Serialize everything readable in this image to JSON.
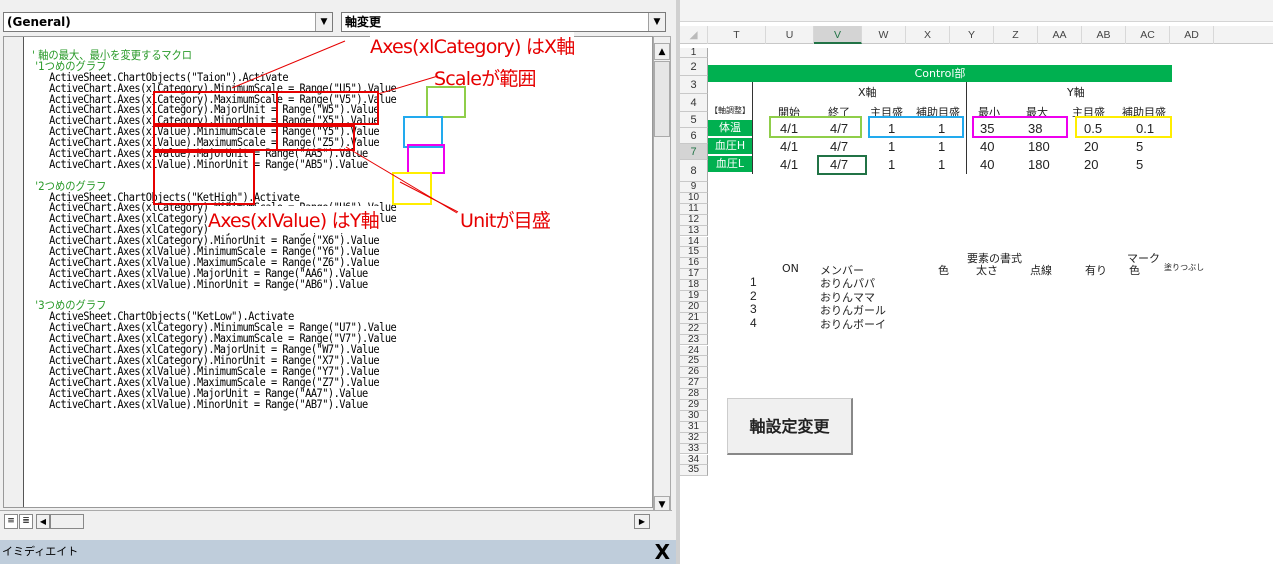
{
  "vbe": {
    "object_combo": "(General)",
    "procedure_combo": "軸変更",
    "code_lines": [
      {
        "type": "comment",
        "text": "' 軸の最大、最小を変更するマクロ"
      },
      {
        "type": "comment",
        "text": " '1つめのグラフ"
      },
      {
        "type": "code",
        "text": "   ActiveSheet.ChartObjects(\"Taion\").Activate"
      },
      {
        "type": "code",
        "text": "   ActiveChart.Axes(xlCategory).MinimumScale = Range(\"U5\").Value"
      },
      {
        "type": "code",
        "text": "   ActiveChart.Axes(xlCategory).MaximumScale = Range(\"V5\").Value"
      },
      {
        "type": "code",
        "text": "   ActiveChart.Axes(xlCategory).MajorUnit = Range(\"W5\").Value"
      },
      {
        "type": "code",
        "text": "   ActiveChart.Axes(xlCategory).MinorUnit = Range(\"X5\").Value"
      },
      {
        "type": "code",
        "text": "   ActiveChart.Axes(xlValue).MinimumScale = Range(\"Y5\").Value"
      },
      {
        "type": "code",
        "text": "   ActiveChart.Axes(xlValue).MaximumScale = Range(\"Z5\").Value"
      },
      {
        "type": "code",
        "text": "   ActiveChart.Axes(xlValue).MajorUnit = Range(\"AA5\").Value"
      },
      {
        "type": "code",
        "text": "   ActiveChart.Axes(xlValue).MinorUnit = Range(\"AB5\").Value"
      },
      {
        "type": "blank",
        "text": ""
      },
      {
        "type": "comment",
        "text": " '2つめのグラフ"
      },
      {
        "type": "code",
        "text": "   ActiveSheet.ChartObjects(\"KetHigh\").Activate"
      },
      {
        "type": "code",
        "text": "   ActiveChart.Axes(xlCategory).MinimumScale = Range(\"U6\").Value"
      },
      {
        "type": "code",
        "text": "   ActiveChart.Axes(xlCategory).MaximumScale = Range(\"V6\").Value"
      },
      {
        "type": "code",
        "text": "   ActiveChart.Axes(xlCategory).MajorUnit = Range(\"W6\").Value"
      },
      {
        "type": "code",
        "text": "   ActiveChart.Axes(xlCategory).MinorUnit = Range(\"X6\").Value"
      },
      {
        "type": "code",
        "text": "   ActiveChart.Axes(xlValue).MinimumScale = Range(\"Y6\").Value"
      },
      {
        "type": "code",
        "text": "   ActiveChart.Axes(xlValue).MaximumScale = Range(\"Z6\").Value"
      },
      {
        "type": "code",
        "text": "   ActiveChart.Axes(xlValue).MajorUnit = Range(\"AA6\").Value"
      },
      {
        "type": "code",
        "text": "   ActiveChart.Axes(xlValue).MinorUnit = Range(\"AB6\").Value"
      },
      {
        "type": "blank",
        "text": ""
      },
      {
        "type": "comment",
        "text": " '3つめのグラフ"
      },
      {
        "type": "code",
        "text": "   ActiveSheet.ChartObjects(\"KetLow\").Activate"
      },
      {
        "type": "code",
        "text": "   ActiveChart.Axes(xlCategory).MinimumScale = Range(\"U7\").Value"
      },
      {
        "type": "code",
        "text": "   ActiveChart.Axes(xlCategory).MaximumScale = Range(\"V7\").Value"
      },
      {
        "type": "code",
        "text": "   ActiveChart.Axes(xlCategory).MajorUnit = Range(\"W7\").Value"
      },
      {
        "type": "code",
        "text": "   ActiveChart.Axes(xlCategory).MinorUnit = Range(\"X7\").Value"
      },
      {
        "type": "code",
        "text": "   ActiveChart.Axes(xlValue).MinimumScale = Range(\"Y7\").Value"
      },
      {
        "type": "code",
        "text": "   ActiveChart.Axes(xlValue).MaximumScale = Range(\"Z7\").Value"
      },
      {
        "type": "code",
        "text": "   ActiveChart.Axes(xlValue).MajorUnit = Range(\"AA7\").Value"
      },
      {
        "type": "code",
        "text": "   ActiveChart.Axes(xlValue).MinorUnit = Range(\"AB7\").Value"
      }
    ],
    "immediate_title": "イミディエイト",
    "close_glyph": "X",
    "annotations": {
      "category_note": "Axes(xlCategory) はX軸",
      "scale_note": "Scaleが範囲",
      "value_note": "Axes(xlValue) はY軸",
      "unit_note": "Unitが目盛"
    },
    "annotation_colors": {
      "red": "#e60000",
      "green": "#8fce4a",
      "blue": "#22aaee",
      "magenta": "#ee00ee",
      "yellow": "#ffee00"
    }
  },
  "excel": {
    "columns": [
      "T",
      "U",
      "V",
      "W",
      "X",
      "Y",
      "Z",
      "AA",
      "AB",
      "AC",
      "AD"
    ],
    "selected_column": "V",
    "rows": [
      "1",
      "2",
      "3",
      "4",
      "5",
      "6",
      "7",
      "8",
      "9",
      "10",
      "11",
      "12",
      "13",
      "14",
      "15",
      "16",
      "17",
      "18",
      "19",
      "20",
      "21",
      "22",
      "23",
      "24",
      "25",
      "26",
      "27",
      "28",
      "29",
      "30",
      "31",
      "32",
      "33",
      "34",
      "35"
    ],
    "selected_row": "7",
    "control_title": "Control部",
    "x_axis_label": "X軸",
    "y_axis_label": "Y軸",
    "adjust_label": "【軸調整】",
    "headers": [
      "開始",
      "終了",
      "主目盛",
      "補助目盛",
      "最小",
      "最大",
      "主目盛",
      "補助目盛"
    ],
    "table_rows": [
      {
        "name": "体温",
        "values": [
          "4/1",
          "4/7",
          "1",
          "1",
          "35",
          "38",
          "0.5",
          "0.1"
        ]
      },
      {
        "name": "血圧H",
        "values": [
          "4/1",
          "4/7",
          "1",
          "1",
          "40",
          "180",
          "20",
          "5"
        ]
      },
      {
        "name": "血圧L",
        "values": [
          "4/1",
          "4/7",
          "1",
          "1",
          "40",
          "180",
          "20",
          "5"
        ]
      }
    ],
    "green_color": "#00b050",
    "format_section": {
      "element_format": "要素の書式",
      "mark": "マーク",
      "headers": [
        "ON",
        "メンバー",
        "色",
        "太さ",
        "点線",
        "有り",
        "色",
        "塗りつぶし"
      ],
      "members": [
        {
          "no": "1",
          "name": "おりんパパ"
        },
        {
          "no": "2",
          "name": "おりんママ"
        },
        {
          "no": "3",
          "name": "おりんガール"
        },
        {
          "no": "4",
          "name": "おりんボーイ"
        }
      ]
    },
    "axis_button_label": "軸設定変更"
  }
}
